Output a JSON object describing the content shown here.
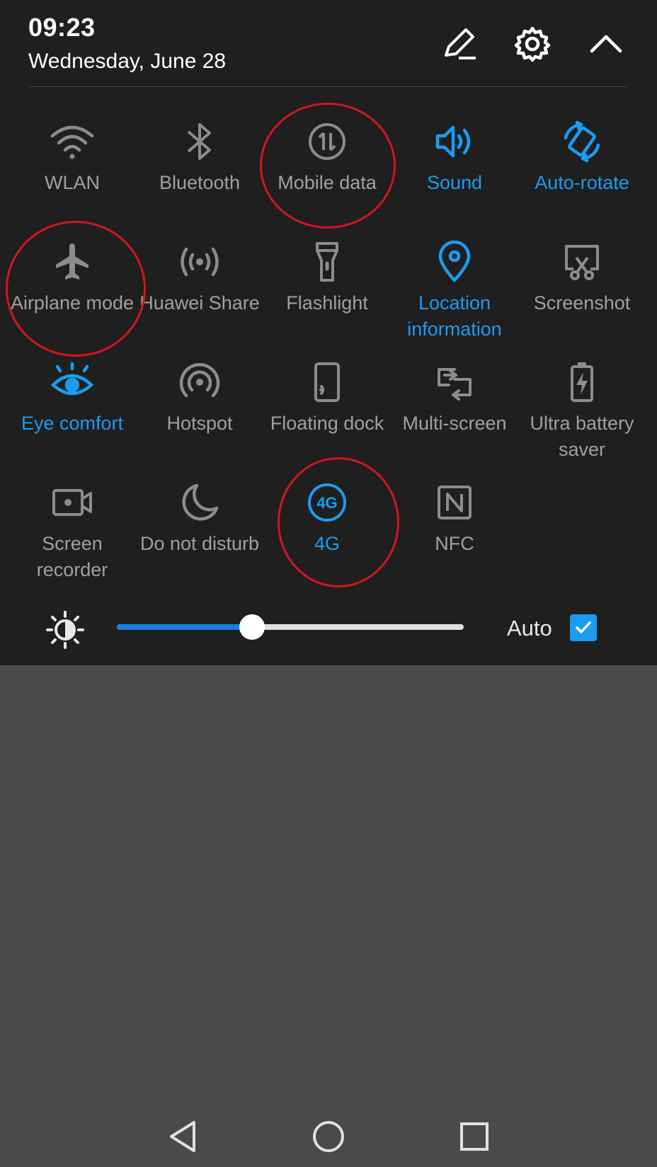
{
  "status": {
    "time": "09:23",
    "date": "Wednesday, June 28"
  },
  "header": {
    "edit_icon": "pencil-icon",
    "settings_icon": "gear-icon",
    "collapse_icon": "chevron-up-icon"
  },
  "tiles": [
    {
      "label": "WLAN",
      "icon": "wifi-icon",
      "active": false
    },
    {
      "label": "Bluetooth",
      "icon": "bluetooth-icon",
      "active": false
    },
    {
      "label": "Mobile data",
      "icon": "mobile-data-icon",
      "active": false
    },
    {
      "label": "Sound",
      "icon": "speaker-icon",
      "active": true
    },
    {
      "label": "Auto-rotate",
      "icon": "rotate-icon",
      "active": true
    },
    {
      "label": "Airplane mode",
      "icon": "airplane-icon",
      "active": false
    },
    {
      "label": "Huawei Share",
      "icon": "share-icon",
      "active": false
    },
    {
      "label": "Flashlight",
      "icon": "flashlight-icon",
      "active": false
    },
    {
      "label": "Location information",
      "icon": "location-pin-icon",
      "active": true
    },
    {
      "label": "Screenshot",
      "icon": "screenshot-icon",
      "active": false
    },
    {
      "label": "Eye comfort",
      "icon": "eye-icon",
      "active": true
    },
    {
      "label": "Hotspot",
      "icon": "hotspot-icon",
      "active": false
    },
    {
      "label": "Floating dock",
      "icon": "floating-dock-icon",
      "active": false
    },
    {
      "label": "Multi-screen",
      "icon": "multi-screen-icon",
      "active": false
    },
    {
      "label": "Ultra battery saver",
      "icon": "battery-icon",
      "active": false
    },
    {
      "label": "Screen recorder",
      "icon": "screen-recorder-icon",
      "active": false
    },
    {
      "label": "Do not disturb",
      "icon": "moon-icon",
      "active": false
    },
    {
      "label": "4G",
      "icon": "4g-icon",
      "active": true
    },
    {
      "label": "NFC",
      "icon": "nfc-icon",
      "active": false
    }
  ],
  "brightness": {
    "level_percent": 39,
    "auto_label": "Auto",
    "auto_checked": true
  },
  "colors": {
    "accent": "#1a9cf0",
    "inactive": "#a0a0a0",
    "annotation": "#d0161d"
  }
}
